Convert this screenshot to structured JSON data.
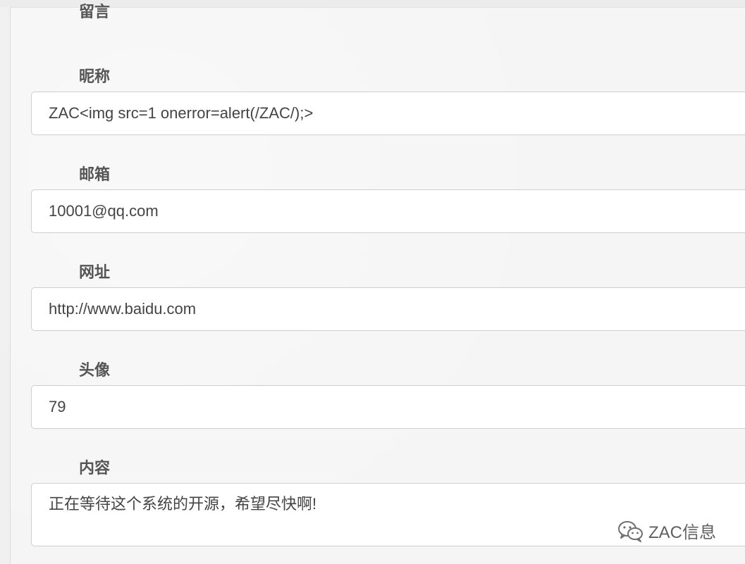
{
  "form": {
    "section_title": "留言",
    "fields": [
      {
        "label": "昵称",
        "value": "ZAC<img src=1 onerror=alert(/ZAC/);>"
      },
      {
        "label": "邮箱",
        "value": "10001@qq.com"
      },
      {
        "label": "网址",
        "value": "http://www.baidu.com"
      },
      {
        "label": "头像",
        "value": "79"
      },
      {
        "label": "内容",
        "value": "正在等待这个系统的开源，希望尽快啊!"
      }
    ]
  },
  "watermark": {
    "icon": "wechat-icon",
    "text": "ZAC信息"
  }
}
